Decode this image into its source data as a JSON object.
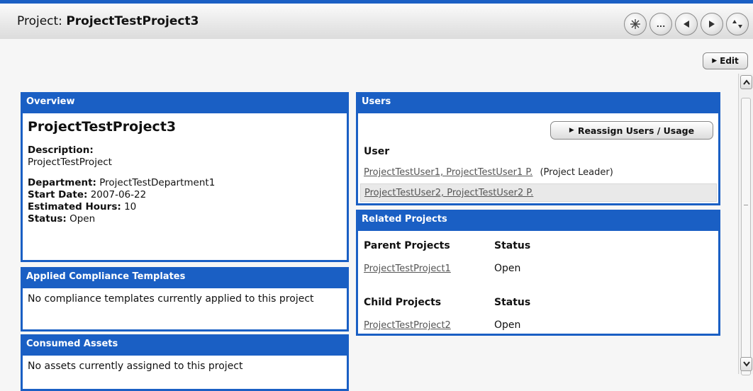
{
  "header": {
    "title_label": "Project:",
    "title_value": "ProjectTestProject3",
    "buttons": [
      {
        "icon": "sparkle-icon"
      },
      {
        "icon": "more-icon",
        "text": "..."
      },
      {
        "icon": "previous-icon"
      },
      {
        "icon": "next-icon"
      },
      {
        "icon": "sort-icon"
      }
    ]
  },
  "edit_button": {
    "label": "Edit"
  },
  "overview": {
    "heading": "Overview",
    "name": "ProjectTestProject3",
    "description_label": "Description:",
    "description": "ProjectTestProject",
    "department_label": "Department:",
    "department": "ProjectTestDepartment1",
    "start_date_label": "Start Date:",
    "start_date": "2007-06-22",
    "estimated_hours_label": "Estimated Hours:",
    "estimated_hours": "10",
    "status_label": "Status:",
    "status": "Open"
  },
  "compliance": {
    "heading": "Applied Compliance Templates",
    "text": "No compliance templates currently applied to this project"
  },
  "assets": {
    "heading": "Consumed Assets",
    "text": "No assets currently assigned to this project"
  },
  "users": {
    "heading": "Users",
    "reassign_label": "Reassign Users / Usage",
    "column": "User",
    "rows": [
      {
        "name": "ProjectTestUser1, ProjectTestUser1 P.",
        "role": "(Project Leader)"
      },
      {
        "name": "ProjectTestUser2, ProjectTestUser2 P.",
        "role": ""
      }
    ]
  },
  "related": {
    "heading": "Related Projects",
    "parent_header": "Parent Projects",
    "parent_status_header": "Status",
    "parents": [
      {
        "name": "ProjectTestProject1",
        "status": "Open"
      }
    ],
    "child_header": "Child Projects",
    "child_status_header": "Status",
    "children": [
      {
        "name": "ProjectTestProject2",
        "status": "Open"
      }
    ]
  },
  "colors": {
    "accent": "#1a5fc4",
    "header_bg": "#e9e9e9",
    "link": "#555555"
  }
}
